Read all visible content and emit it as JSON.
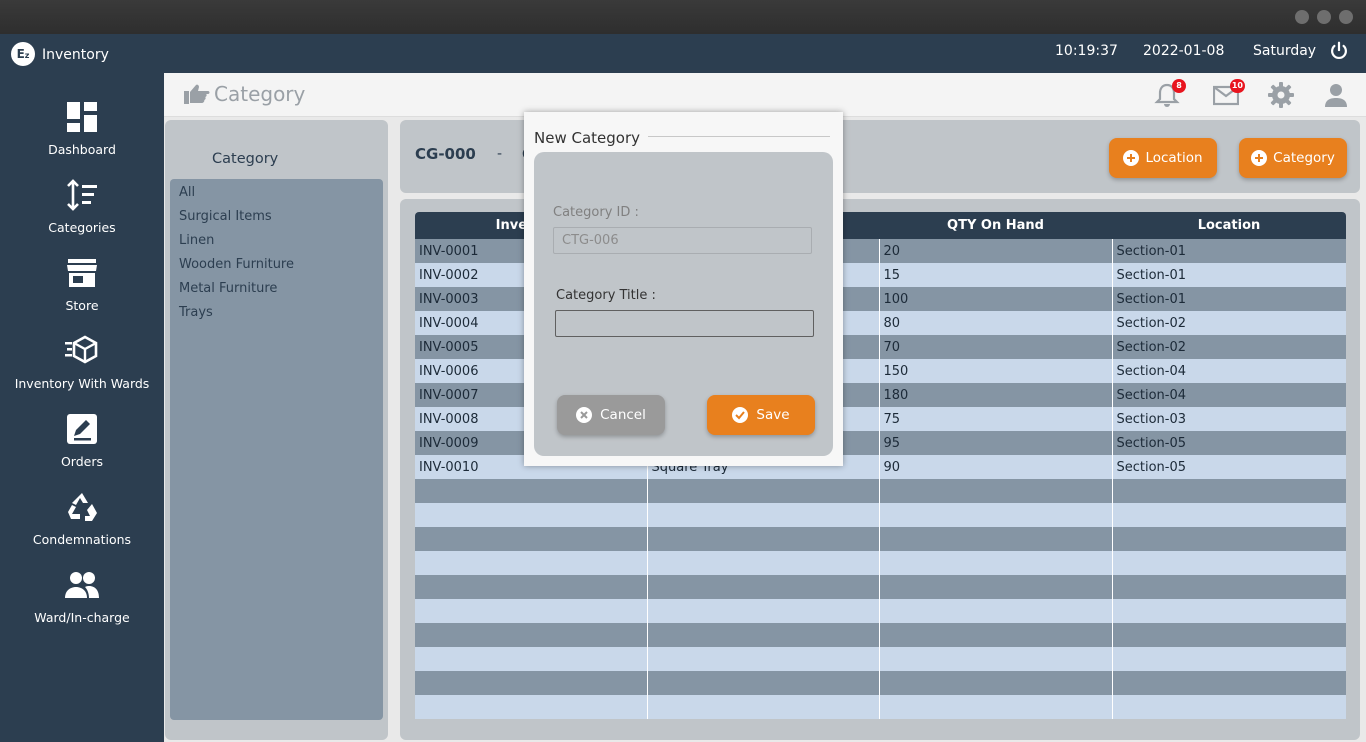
{
  "app": {
    "logo_text": "E",
    "logo_sub": "z",
    "title": "Inventory"
  },
  "header": {
    "time": "10:19:37",
    "date": "2022-01-08",
    "day": "Saturday"
  },
  "sidebar": {
    "items": [
      {
        "label": "Dashboard"
      },
      {
        "label": "Categories"
      },
      {
        "label": "Store"
      },
      {
        "label": "Inventory With Wards"
      },
      {
        "label": "Orders"
      },
      {
        "label": "Condemnations"
      },
      {
        "label": "Ward/In-charge"
      }
    ]
  },
  "topbar": {
    "title": "Category",
    "notifications": "8",
    "messages": "10"
  },
  "category_panel": {
    "title": "Category",
    "items": [
      "All",
      "Surgical Items",
      "Linen",
      "Wooden Furniture",
      "Metal Furniture",
      "Trays"
    ]
  },
  "info_bar": {
    "id": "CG-000",
    "dash": "-",
    "extra": "C",
    "location_button": "Location",
    "category_button": "Category"
  },
  "table": {
    "headers": [
      "Inventory",
      "",
      "QTY On Hand",
      "Location"
    ],
    "rows": [
      [
        "INV-0001",
        "",
        "20",
        "Section-01"
      ],
      [
        "INV-0002",
        "",
        "15",
        "Section-01"
      ],
      [
        "INV-0003",
        "",
        "100",
        "Section-01"
      ],
      [
        "INV-0004",
        "",
        "80",
        "Section-02"
      ],
      [
        "INV-0005",
        "",
        "70",
        "Section-02"
      ],
      [
        "INV-0006",
        "",
        "150",
        "Section-04"
      ],
      [
        "INV-0007",
        "",
        "180",
        "Section-04"
      ],
      [
        "INV-0008",
        "",
        "75",
        "Section-03"
      ],
      [
        "INV-0009",
        "",
        "95",
        "Section-05"
      ],
      [
        "INV-0010",
        "Square Tray",
        "90",
        "Section-05"
      ]
    ],
    "empty_rows": 10
  },
  "modal": {
    "title": "New Category",
    "id_label": "Category ID :",
    "id_value": "CTG-006",
    "title_label": "Category Title :",
    "title_value": "",
    "cancel_label": "Cancel",
    "save_label": "Save"
  },
  "colors": {
    "primary": "#2c3e50",
    "accent": "#e8801e",
    "row_dark": "#8595a4",
    "row_light": "#c9d8ea",
    "badge": "#e8141e"
  }
}
